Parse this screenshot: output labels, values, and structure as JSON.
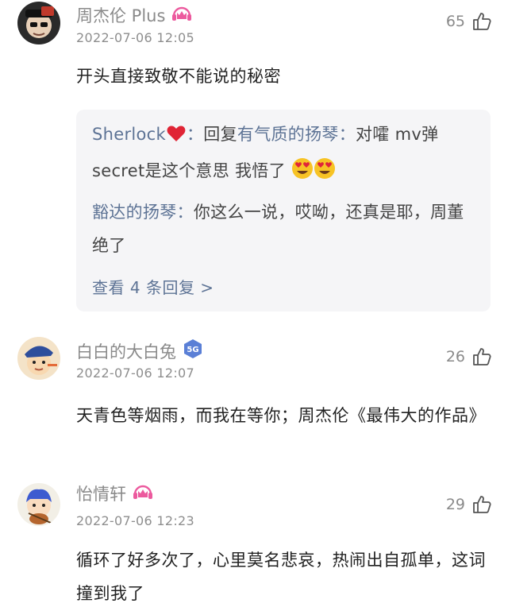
{
  "comments": [
    {
      "username": "周杰伦 Plus",
      "badge": "crown-headphones-badge",
      "timestamp": "2022-07-06 12:05",
      "likes": "65",
      "text": "开头直接致敬不能说的秘密",
      "replies": {
        "items": [
          {
            "author": "Sherlock",
            "author_suffix": "：",
            "reply_prefix": "回复",
            "reply_to": "有气质的扬琴",
            "reply_to_suffix": "：",
            "text": "对嚯 mv弹secret是这个意思 我悟了"
          },
          {
            "author": "豁达的扬琴",
            "author_suffix": "：",
            "text": "你这么一说，哎呦，还真是耶，周董绝了"
          }
        ],
        "view_more": "查看 4 条回复 >"
      }
    },
    {
      "username": "白白的大白兔",
      "badge": "5G",
      "timestamp": "2022-07-06 12:07",
      "likes": "26",
      "text": "天青色等烟雨，而我在等你；周杰伦《最伟大的作品》"
    },
    {
      "username": "怡情轩",
      "badge": "crown-headphones-badge",
      "timestamp": "2022-07-06 12:23",
      "likes": "29",
      "text": "循环了好多次了，心里莫名悲哀，热闹出自孤单，这词撞到我了"
    }
  ],
  "colors": {
    "link_blue": "#5d7395",
    "muted_gray": "#8a8a8a",
    "reply_bg": "#f5f5f7",
    "badge_pink": "#ec5a9e",
    "badge_blue": "#5a7fd6"
  }
}
